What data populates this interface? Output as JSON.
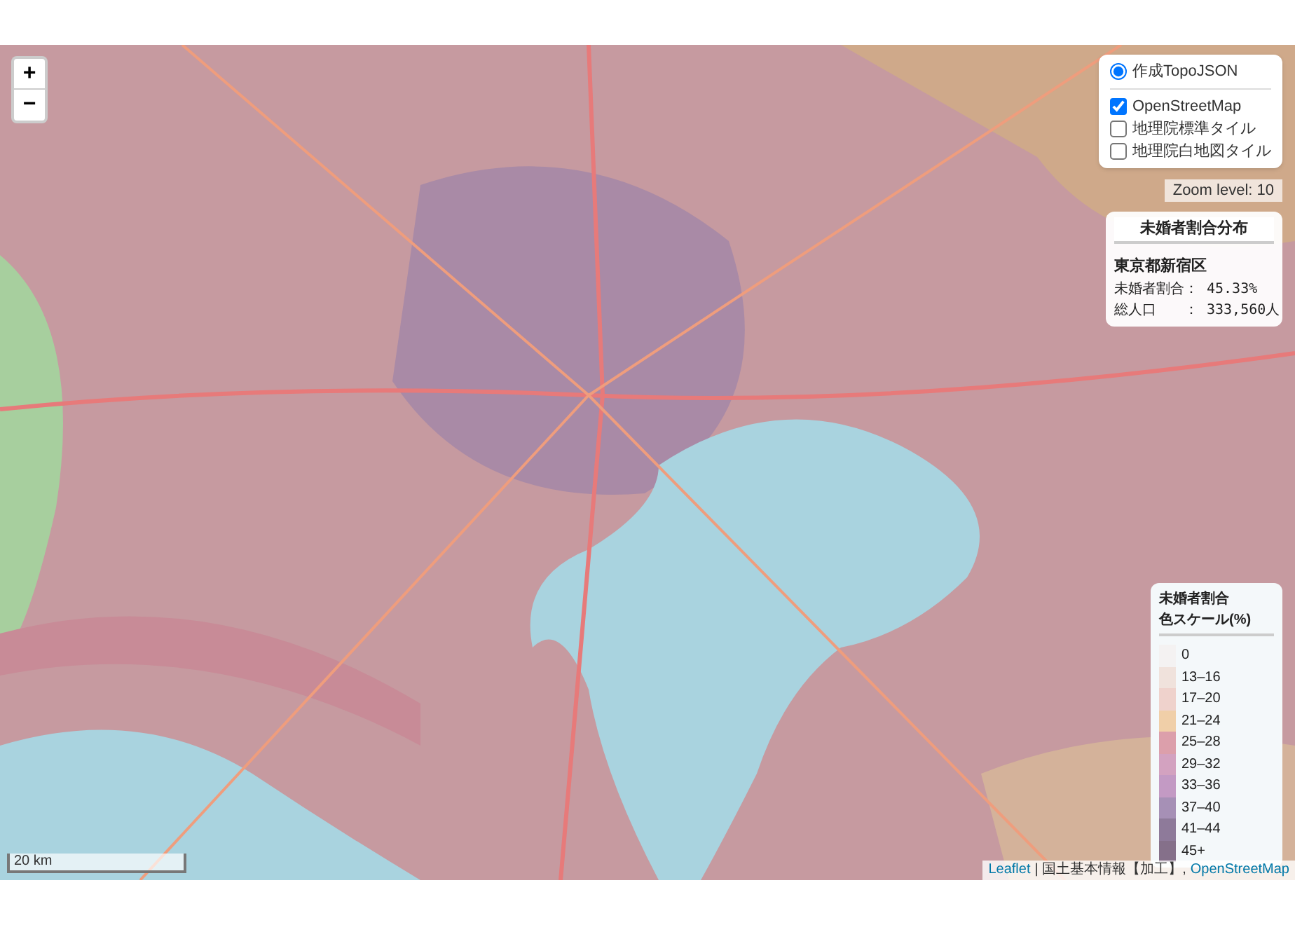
{
  "zoom_controls": [
    {
      "label": "+"
    },
    {
      "label": "−"
    }
  ],
  "layers": [
    [
      {
        "kind": "radio",
        "label": "作成TopoJSON",
        "checked": true
      }
    ],
    [
      {
        "kind": "checkbox",
        "label": "OpenStreetMap",
        "checked": true
      },
      {
        "kind": "checkbox",
        "label": "地理院標準タイル",
        "checked": false
      },
      {
        "kind": "checkbox",
        "label": "地理院白地図タイル",
        "checked": false
      }
    ]
  ],
  "zoom_level": "Zoom level: 10",
  "info": {
    "title": "未婚者割合分布",
    "region": "東京都新宿区",
    "rows": [
      {
        "label": "未婚者割合：",
        "value": "45.33%"
      },
      {
        "label": "総人口　　：",
        "value": "333,560人"
      }
    ]
  },
  "legend": {
    "title": [
      "未婚者割合",
      "色スケール(%)"
    ],
    "items": [
      {
        "label": "0",
        "color": "#f4f2f2"
      },
      {
        "label": "13–16",
        "color": "#f0e2dc"
      },
      {
        "label": "17–20",
        "color": "#efd2cc"
      },
      {
        "label": "21–24",
        "color": "#f0cfa8"
      },
      {
        "label": "25–28",
        "color": "#dc9fab"
      },
      {
        "label": "29–32",
        "color": "#d3a2c0"
      },
      {
        "label": "33–36",
        "color": "#c39ac4"
      },
      {
        "label": "37–40",
        "color": "#a690b6"
      },
      {
        "label": "41–44",
        "color": "#8e7a9a"
      },
      {
        "label": "45+",
        "color": "#85708a"
      }
    ]
  },
  "scale": "20 km",
  "attribution": {
    "links": [
      "Leaflet",
      "OpenStreetMap"
    ],
    "text": "| 国土基本情報【加工】,"
  }
}
